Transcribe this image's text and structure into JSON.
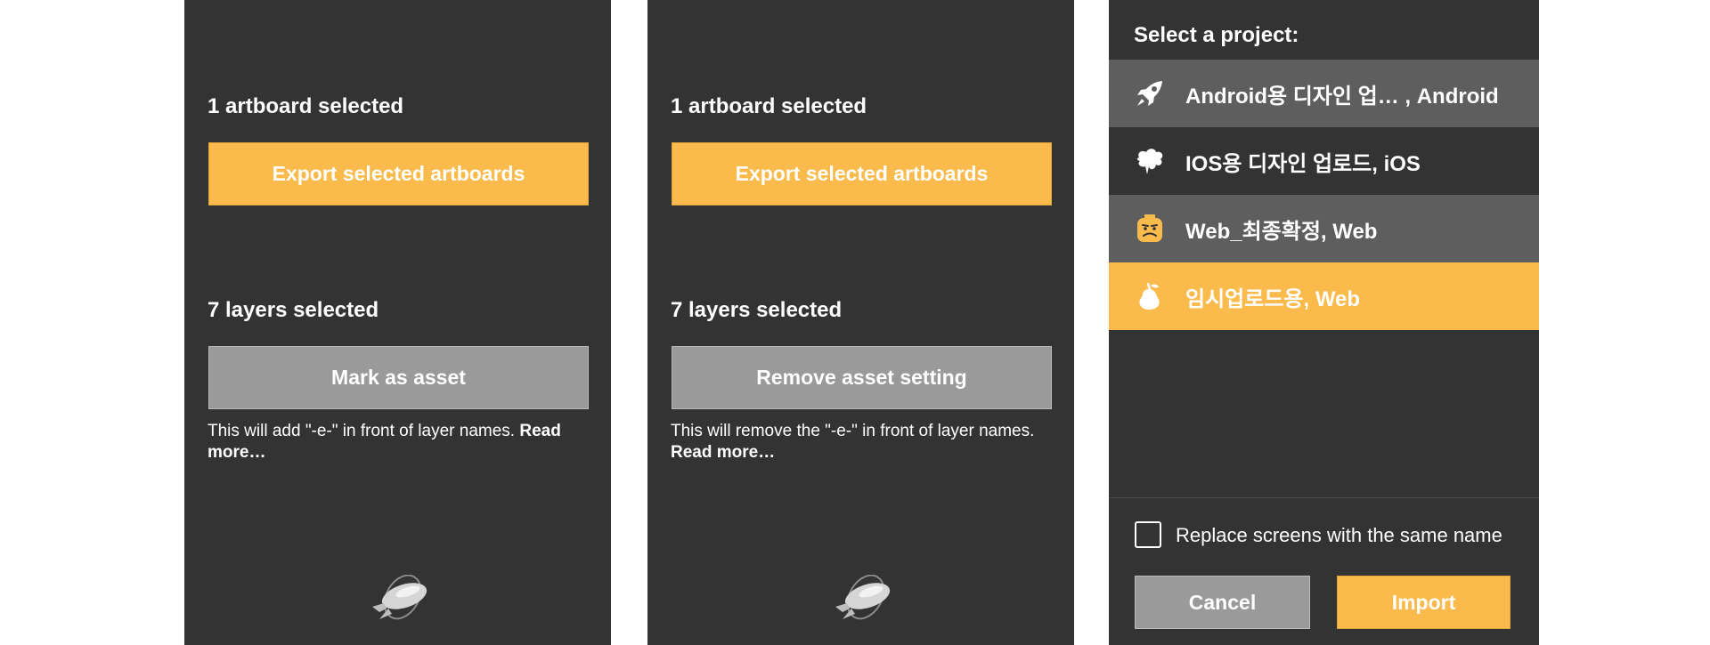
{
  "panel1": {
    "artboard_label": "1 artboard selected",
    "export_button": "Export selected artboards",
    "layers_label": "7 layers selected",
    "asset_button": "Mark as asset",
    "description": "This will add \"-e-\" in front of layer names.",
    "read_more": "Read more…"
  },
  "panel2": {
    "artboard_label": "1 artboard selected",
    "export_button": "Export selected artboards",
    "layers_label": "7 layers selected",
    "asset_button": "Remove asset setting",
    "description": "This will remove the \"-e-\" in front of layer names.",
    "read_more": "Read more…"
  },
  "panel3": {
    "title": "Select a project:",
    "projects": [
      {
        "label": "Android용 디자인 업… , Android",
        "icon": "rocket-icon"
      },
      {
        "label": "IOS용 디자인 업로드, iOS",
        "icon": "ink-splash-icon"
      },
      {
        "label": "Web_최종확정, Web",
        "icon": "lego-face-icon"
      },
      {
        "label": "임시업로드용, Web",
        "icon": "pear-icon"
      }
    ],
    "checkbox_label": "Replace screens with the same name",
    "cancel_label": "Cancel",
    "import_label": "Import"
  },
  "colors": {
    "panel_bg": "#333333",
    "accent_yellow": "#fbbb4c",
    "button_gray": "#9a9a9a",
    "row_gray": "#5e5e5e"
  }
}
